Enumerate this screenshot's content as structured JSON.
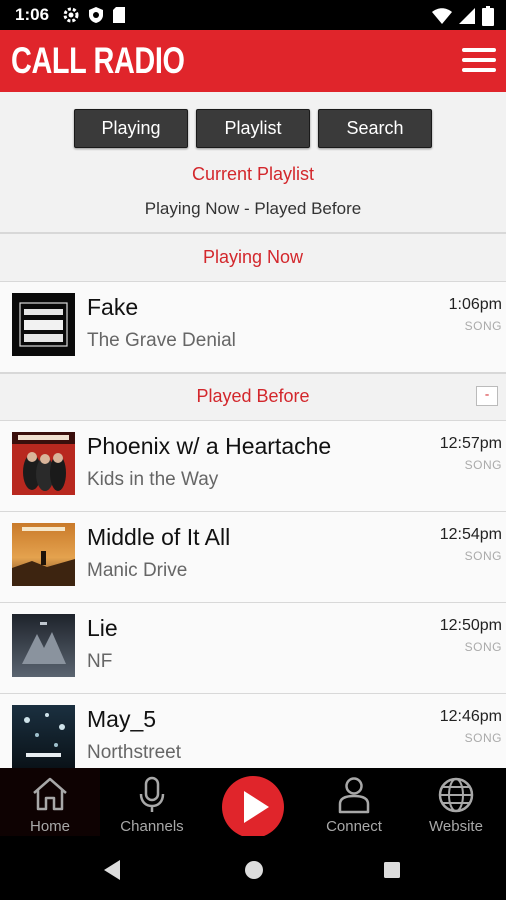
{
  "status_bar": {
    "time": "1:06"
  },
  "app": {
    "title": "CALL RADIO"
  },
  "tabs": [
    {
      "label": "Playing"
    },
    {
      "label": "Playlist"
    },
    {
      "label": "Search"
    }
  ],
  "playlist": {
    "heading": "Current Playlist",
    "subtitle": "Playing Now - Played Before",
    "playing_now_label": "Playing Now",
    "played_before_label": "Played Before",
    "collapse_label": "-"
  },
  "now_playing": {
    "title": "Fake",
    "artist": "The Grave Denial",
    "time": "1:06pm",
    "type": "SONG"
  },
  "played_before": [
    {
      "title": "Phoenix w/ a Heartache",
      "artist": "Kids in the Way",
      "time": "12:57pm",
      "type": "SONG"
    },
    {
      "title": "Middle of It All",
      "artist": "Manic Drive",
      "time": "12:54pm",
      "type": "SONG"
    },
    {
      "title": "Lie",
      "artist": "NF",
      "time": "12:50pm",
      "type": "SONG"
    },
    {
      "title": "May_5",
      "artist": "Northstreet",
      "time": "12:46pm",
      "type": "SONG"
    }
  ],
  "bottom_nav": {
    "home": "Home",
    "channels": "Channels",
    "connect": "Connect",
    "website": "Website"
  },
  "colors": {
    "brand_red": "#e0252b",
    "text_red": "#d3272c"
  }
}
